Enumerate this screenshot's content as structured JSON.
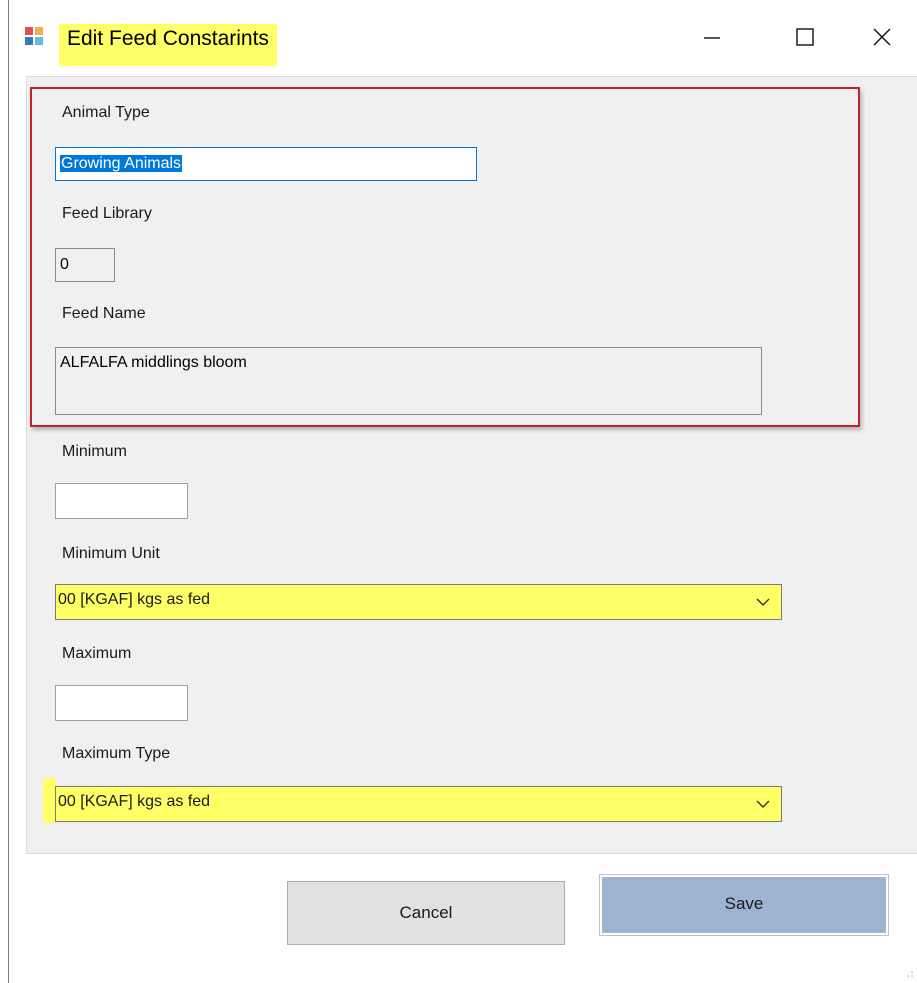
{
  "window": {
    "title": "Edit Feed Constarints",
    "controls": {
      "minimize": "–",
      "maximize": "□",
      "close": "✕"
    },
    "highlight_color": "#ffff66"
  },
  "form": {
    "animal_type": {
      "label": "Animal Type",
      "value": "Growing Animals"
    },
    "feed_library": {
      "label": "Feed Library",
      "value": "0"
    },
    "feed_name": {
      "label": "Feed Name",
      "value": "ALFALFA middlings bloom"
    },
    "minimum": {
      "label": "Minimum",
      "value": ""
    },
    "minimum_unit": {
      "label": "Minimum Unit",
      "value": "00 [KGAF] kgs as fed"
    },
    "maximum": {
      "label": "Maximum",
      "value": ""
    },
    "maximum_type": {
      "label": "Maximum Type",
      "value": "00 [KGAF] kgs as fed"
    }
  },
  "buttons": {
    "cancel": "Cancel",
    "save": "Save"
  },
  "colors": {
    "annotation_box": "#c0232b",
    "save_button": "#9cb4d2",
    "selection": "#0078d7"
  }
}
